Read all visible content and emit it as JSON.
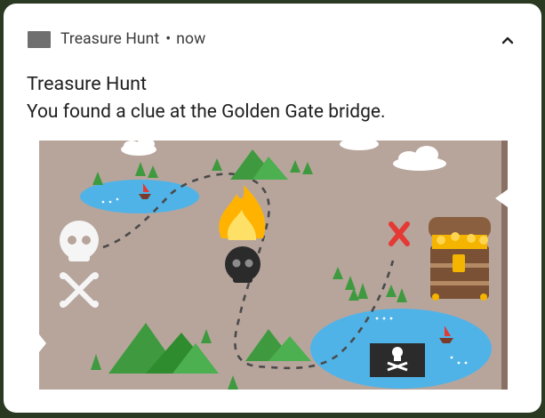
{
  "notification": {
    "app_name": "Treasure Hunt",
    "separator": "•",
    "time": "now",
    "title": "Treasure Hunt",
    "message": "You found a clue at the Golden Gate bridge.",
    "expand_icon": "chevron-up-icon",
    "app_icon": "app-icon",
    "image": "treasure-map-illustration"
  },
  "colors": {
    "card_background": "#ffffff",
    "map_ground": "#b7a59c",
    "lake": "#4fb3e8",
    "trees": "#3f9a3f",
    "path": "#4a4a4a",
    "x_mark": "#e53935",
    "chest": "#7a5134",
    "gold": "#f4b400",
    "fire": "#ffb300"
  }
}
